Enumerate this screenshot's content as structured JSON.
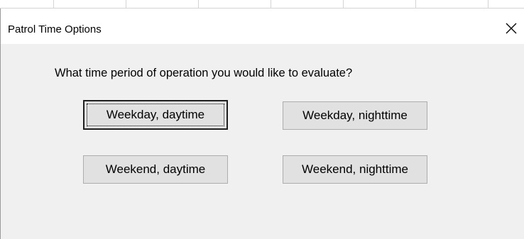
{
  "dialog": {
    "title": "Patrol Time Options",
    "close_icon": "close-icon",
    "prompt": "What time period of operation you would like to evaluate?",
    "buttons": {
      "weekday_daytime": "Weekday, daytime",
      "weekday_nighttime": "Weekday, nighttime",
      "weekend_daytime": "Weekend, daytime",
      "weekend_nighttime": "Weekend, nighttime"
    },
    "default_button": "weekday_daytime"
  },
  "colors": {
    "dialog_bg": "#f0f0f0",
    "titlebar_bg": "#ffffff",
    "button_bg": "#e1e1e1",
    "button_border": "#adadad"
  }
}
